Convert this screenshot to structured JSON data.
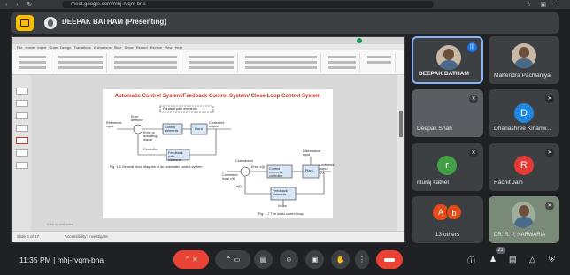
{
  "browser": {
    "url": "meet.google.com/mhj-rvqm-bna"
  },
  "presenter_bar": {
    "name": "DEEPAK BATHAM (Presenting)"
  },
  "slide": {
    "title": "Automatic Control System/Feedback Control System/ Close Loop Control System",
    "fig1_caption": "Fig. 1.6   General block diagram of an automatic control system.",
    "fig2_caption": "Fig. 1.7      The basic control loop.",
    "labels": {
      "forward_path": "Forward path elements",
      "reference": "Reference input",
      "error_detector": "Error detector",
      "error_signal": "Error or actuating signal",
      "control_elements": "Control elements",
      "plant": "Plant",
      "controlled_output": "Controlled output",
      "controller": "Controller",
      "feedback_path": "Feedback path elements",
      "comparator": "Comparator",
      "disturbance": "Disturbance input",
      "command": "Command input r(t)",
      "error_e": "Error e(t)",
      "control_elements_2": "Control elements controller",
      "plant_2": "Plant",
      "output_c": "Controlled output c(t)",
      "feedback_elements": "Feedback elements",
      "noise": "Noise",
      "bt": "b(t)"
    }
  },
  "ppt": {
    "tabs": "File  Home  Insert  Draw  Design  Transitions  Animations  Slide Show  Record  Review  View  Help",
    "status_left": "Slide 6 of 17",
    "status_right": "Accessibility: Investigate",
    "notes": "Click to add notes"
  },
  "participants": [
    {
      "name": "DEEPAK BATHAM",
      "type": "photo"
    },
    {
      "name": "Mahendra Pachlaniya",
      "type": "photo"
    },
    {
      "name": "Deepak Shah",
      "type": "video"
    },
    {
      "name": "Dhanashree Kinariw...",
      "letter": "D",
      "color": "#1e88e5"
    },
    {
      "name": "rituraj kathel",
      "letter": "r",
      "color": "#43a047"
    },
    {
      "name": "Rachit Jain",
      "letter": "R",
      "color": "#e53935"
    },
    {
      "name": "13 others",
      "letters": [
        "A",
        "b"
      ],
      "color": "#e64a19"
    },
    {
      "name": "DR. R. P. NARWARIA",
      "type": "video"
    }
  ],
  "meeting": {
    "time": "11:35 PM",
    "separator": "|",
    "code": "mhj-rvqm-bna",
    "people_count": "21"
  },
  "colors": {
    "accent_blue": "#8ab4f8",
    "end_call_red": "#ea4335",
    "present_yellow": "#fbbc04"
  }
}
